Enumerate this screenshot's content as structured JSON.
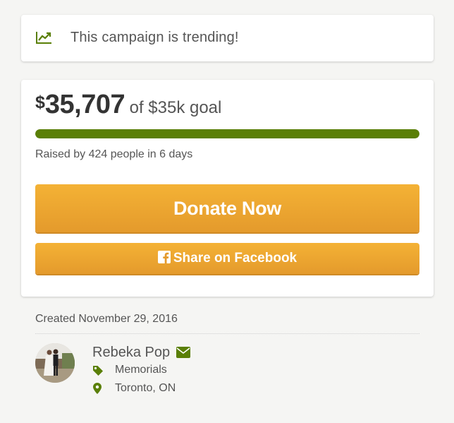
{
  "trending": {
    "text": "This campaign is trending!",
    "icon": "trending-up-icon"
  },
  "funding": {
    "currency_symbol": "$",
    "amount": "35,707",
    "goal_text": "of $35k goal",
    "progress_percent": 100,
    "raised_text": "Raised by 424 people in 6 days"
  },
  "buttons": {
    "donate_label": "Donate Now",
    "share_label": "Share on Facebook"
  },
  "details": {
    "created_text": "Created November 29, 2016",
    "organizer_name": "Rebeka Pop",
    "category": "Memorials",
    "location": "Toronto, ON"
  },
  "colors": {
    "accent_green": "#5a7f07",
    "button_orange": "#f4b235",
    "page_bg": "#f5f5f3"
  }
}
